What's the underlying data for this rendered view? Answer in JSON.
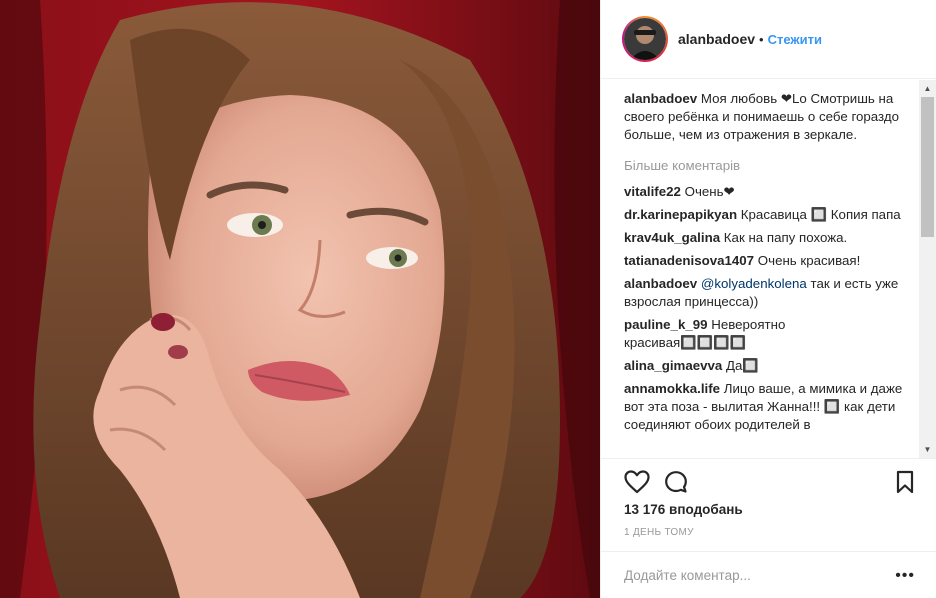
{
  "header": {
    "username": "alanbadoev",
    "separator": "•",
    "follow_label": "Стежити"
  },
  "caption": {
    "username": "alanbadoev",
    "text": "Моя любовь ❤Lo Смотришь на своего ребёнка и понимаешь о себе гораздо больше, чем из отражения в зеркале."
  },
  "more_comments_label": "Більше коментарів",
  "comments": [
    {
      "username": "vitalife22",
      "text": "Очень❤"
    },
    {
      "username": "dr.karinepapikyan",
      "text": "Красавица 🔲 Копия папа"
    },
    {
      "username": "krav4uk_galina",
      "text": "Как на папу похожа."
    },
    {
      "username": "tatianadenisova1407",
      "text": "Очень красивая!"
    },
    {
      "username": "alanbadoev",
      "mention": "@kolyadenkolena",
      "text": "так и есть уже взрослая принцесса))"
    },
    {
      "username": "pauline_k_99",
      "text": "Невероятно красивая🔲🔲🔲🔲"
    },
    {
      "username": "alina_gimaevva",
      "text": "Да🔲"
    },
    {
      "username": "annamokka.life",
      "text": "Лицо ваше, а мимика и даже вот эта поза - вылитая Жанна!!! 🔲 как дети соединяют обоих родителей в"
    }
  ],
  "icons": {
    "like": "heart-icon",
    "comment": "comment-icon",
    "save": "bookmark-icon",
    "more": "ellipsis-icon"
  },
  "likes_label": "13 176 вподобань",
  "time_label": "1 день тому",
  "add_comment_placeholder": "Додайте коментар...",
  "more_options": "•••",
  "colors": {
    "link": "#3897f0",
    "text": "#262626",
    "muted": "#999999",
    "background_red": "#6b0c12"
  }
}
